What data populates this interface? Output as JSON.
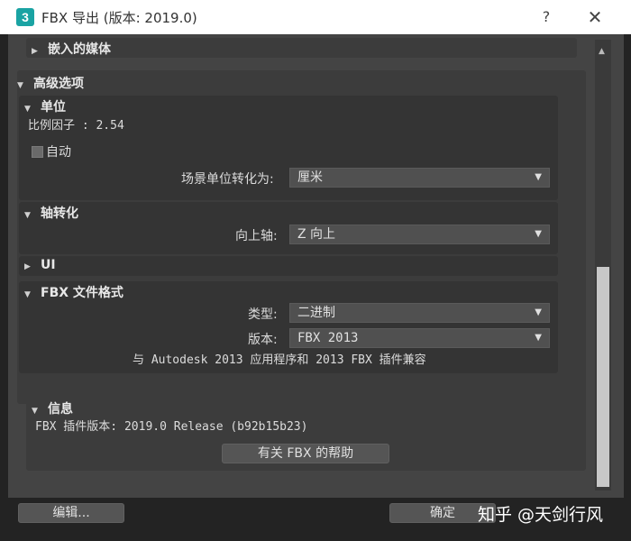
{
  "window": {
    "title": "FBX 导出 (版本: 2019.0)",
    "app_icon_text": "3",
    "help_label": "?",
    "close_label": "✕"
  },
  "sections": {
    "embedded_media": {
      "label": "嵌入的媒体",
      "expanded": false
    },
    "advanced": {
      "label": "高级选项",
      "expanded": true
    },
    "units": {
      "label": "单位",
      "scale_factor_text": "比例因子 : 2.54",
      "auto_label": "自动",
      "auto_checked": false,
      "convert_label": "场景单位转化为:",
      "convert_value": "厘米"
    },
    "axis": {
      "label": "轴转化",
      "up_axis_label": "向上轴:",
      "up_axis_value": "Z 向上"
    },
    "ui": {
      "label": "UI",
      "expanded": false
    },
    "fbx_format": {
      "label": "FBX 文件格式",
      "type_label": "类型:",
      "type_value": "二进制",
      "version_label": "版本:",
      "version_value": "FBX 2013",
      "compat_text": "与 Autodesk 2013 应用程序和 2013 FBX 插件兼容"
    },
    "info": {
      "label": "信息",
      "plugin_version_text": "FBX 插件版本: 2019.0 Release (b92b15b23)",
      "help_button": "有关 FBX 的帮助"
    }
  },
  "footer": {
    "edit_button": "编辑...",
    "ok_button": "确定"
  },
  "watermark": "知乎 @天剑行风",
  "icons": {
    "expanded": "▼",
    "collapsed": "▶",
    "dropdown": "▼"
  },
  "colors": {
    "app_icon": "#1aa3a3",
    "panel": "#3c3c3c",
    "frame": "#444444"
  }
}
